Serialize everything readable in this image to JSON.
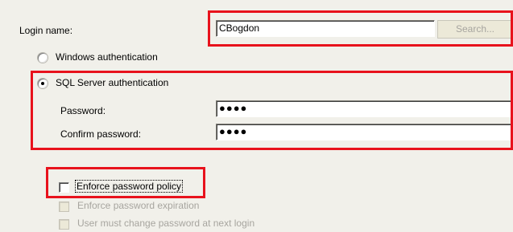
{
  "login": {
    "label": "Login name:",
    "value": "CBogdon",
    "search_label": "Search..."
  },
  "auth": {
    "windows_label": "Windows authentication",
    "sql_label": "SQL Server authentication",
    "selected": "sql"
  },
  "password": {
    "label": "Password:",
    "value": "●●●●",
    "confirm_label": "Confirm password:",
    "confirm_value": "●●●●"
  },
  "policy": {
    "enforce_policy_label": "Enforce password policy",
    "enforce_policy_checked": false,
    "enforce_expiration_label": "Enforce password expiration",
    "enforce_expiration_checked": false,
    "enforce_expiration_enabled": false,
    "must_change_label": "User must change password at next login",
    "must_change_checked": false,
    "must_change_enabled": false
  },
  "colors": {
    "highlight": "#e8121c",
    "dialog_background": "#f1f0ea",
    "disabled_text": "#a7a59f"
  }
}
